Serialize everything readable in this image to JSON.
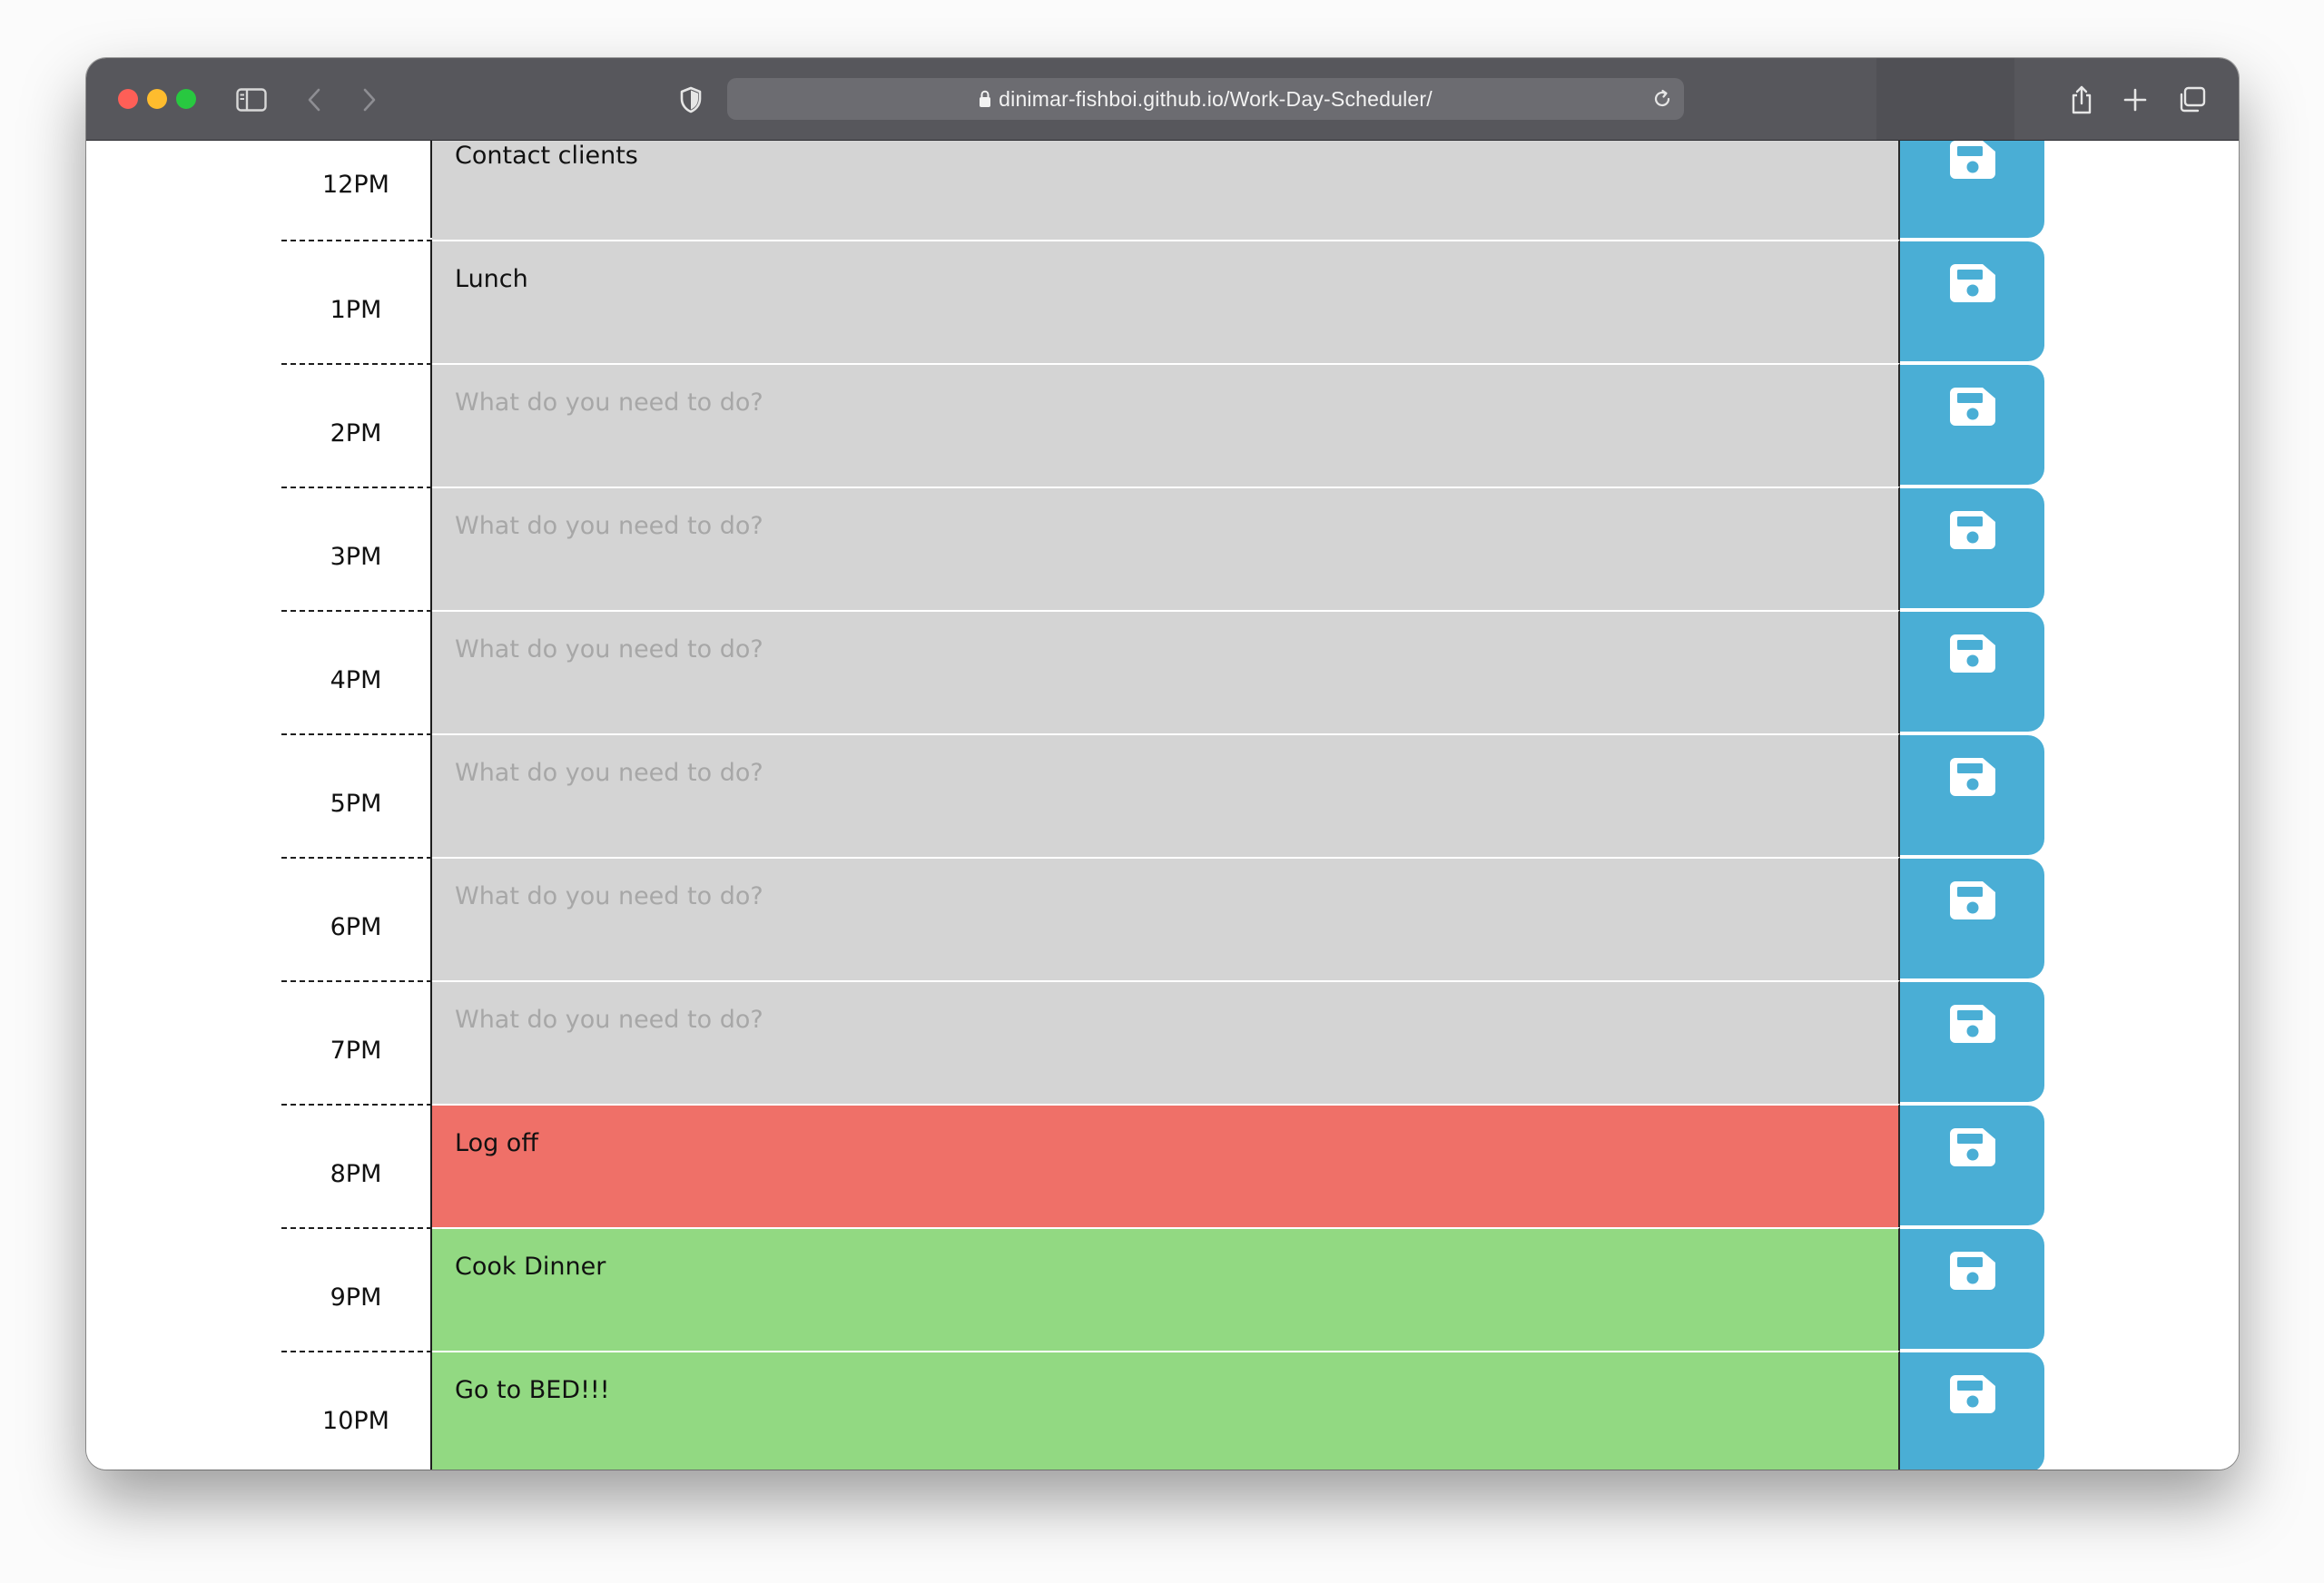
{
  "browser": {
    "url": "dinimar-fishboi.github.io/Work-Day-Scheduler/"
  },
  "colors": {
    "past": "#d4d4d4",
    "present": "#ef7068",
    "future": "#92d982",
    "save_button": "#4aaed5"
  },
  "scheduler": {
    "placeholder": "What do you need to do?",
    "rows": [
      {
        "hour": "12PM",
        "text": "Contact clients",
        "status": "past"
      },
      {
        "hour": "1PM",
        "text": "Lunch",
        "status": "past"
      },
      {
        "hour": "2PM",
        "text": "",
        "status": "past"
      },
      {
        "hour": "3PM",
        "text": "",
        "status": "past"
      },
      {
        "hour": "4PM",
        "text": "",
        "status": "past"
      },
      {
        "hour": "5PM",
        "text": "",
        "status": "past"
      },
      {
        "hour": "6PM",
        "text": "",
        "status": "past"
      },
      {
        "hour": "7PM",
        "text": "",
        "status": "past"
      },
      {
        "hour": "8PM",
        "text": "Log off",
        "status": "present"
      },
      {
        "hour": "9PM",
        "text": "Cook Dinner",
        "status": "future"
      },
      {
        "hour": "10PM",
        "text": "Go to BED!!!",
        "status": "future"
      }
    ],
    "save_icon": "floppy-disk-icon"
  }
}
